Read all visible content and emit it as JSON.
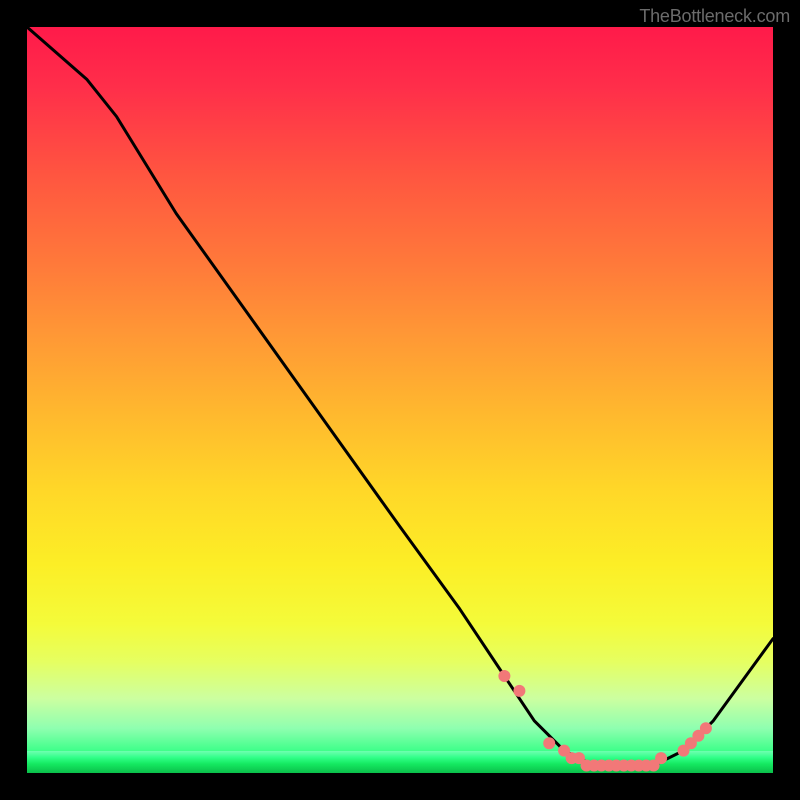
{
  "watermark": "TheBottleneck.com",
  "chart_data": {
    "type": "line",
    "title": "",
    "xlabel": "",
    "ylabel": "",
    "xlim": [
      0,
      100
    ],
    "ylim": [
      0,
      100
    ],
    "series": [
      {
        "name": "bottleneck-curve",
        "x": [
          0,
          8,
          12,
          20,
          30,
          40,
          50,
          58,
          64,
          68,
          72,
          76,
          80,
          84,
          88,
          92,
          100
        ],
        "values": [
          100,
          93,
          88,
          75,
          61,
          47,
          33,
          22,
          13,
          7,
          3,
          1,
          1,
          1,
          3,
          7,
          18
        ]
      }
    ],
    "markers": {
      "name": "highlight-dots",
      "x": [
        64,
        66,
        70,
        72,
        73,
        74,
        75,
        76,
        77,
        78,
        79,
        80,
        81,
        82,
        83,
        84,
        85,
        88,
        89,
        90,
        91
      ],
      "values": [
        13,
        11,
        4,
        3,
        2,
        2,
        1,
        1,
        1,
        1,
        1,
        1,
        1,
        1,
        1,
        1,
        2,
        3,
        4,
        5,
        6
      ]
    },
    "gradient_stops": [
      {
        "pct": 0,
        "color": "#ff1a4a"
      },
      {
        "pct": 20,
        "color": "#ff5640"
      },
      {
        "pct": 42,
        "color": "#ff9a35"
      },
      {
        "pct": 62,
        "color": "#ffd728"
      },
      {
        "pct": 80,
        "color": "#f4fb3a"
      },
      {
        "pct": 94,
        "color": "#8fffb0"
      },
      {
        "pct": 100,
        "color": "#0bbf4a"
      }
    ]
  }
}
